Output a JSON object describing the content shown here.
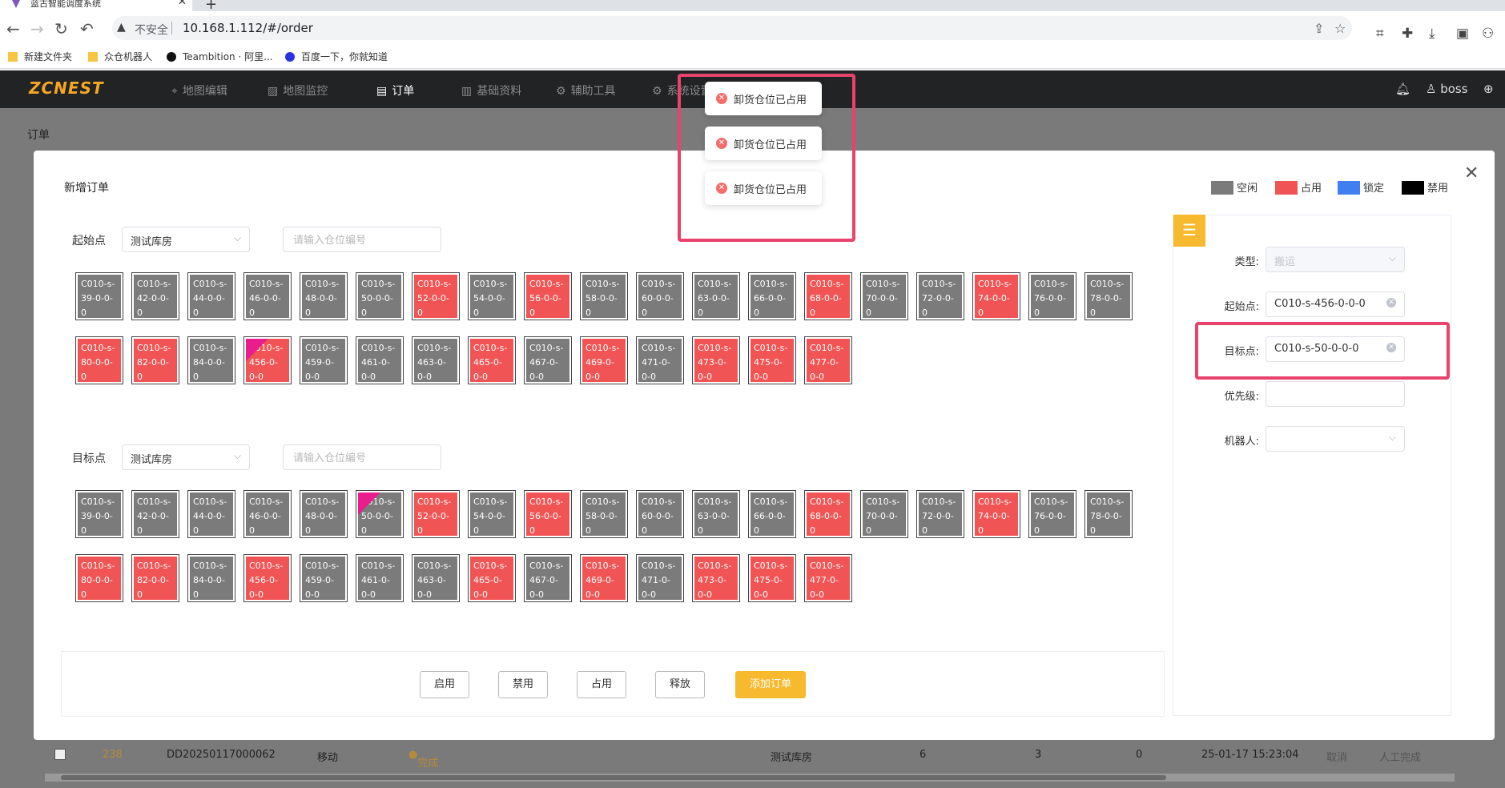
{
  "browser": {
    "tab_title": "蓝古智能调度系统",
    "url": "10.168.1.112/#/order",
    "insecure_label": "不安全",
    "bookmarks": [
      {
        "label": "新建文件夹",
        "icon": "folder-icon"
      },
      {
        "label": "众仓机器人",
        "icon": "folder-icon"
      },
      {
        "label": "Teambition · 阿里...",
        "icon": "teambition-icon"
      },
      {
        "label": "百度一下，你就知道",
        "icon": "baidu-icon"
      }
    ]
  },
  "app": {
    "logo": "ZCNEST",
    "menu": [
      {
        "label": "地图编辑",
        "icon": "map-pin-icon",
        "glyph": "⌖"
      },
      {
        "label": "地图监控",
        "icon": "monitor-icon",
        "glyph": "▨"
      },
      {
        "label": "订单",
        "icon": "order-icon",
        "glyph": "▤"
      },
      {
        "label": "基础资料",
        "icon": "data-icon",
        "glyph": "▥"
      },
      {
        "label": "辅助工具",
        "icon": "tools-icon",
        "glyph": "⚙"
      },
      {
        "label": "系统设置",
        "icon": "settings-icon",
        "glyph": "⚙"
      }
    ],
    "user": "boss",
    "breadcrumb": "订单"
  },
  "background_row": {
    "id": "238",
    "order_no": "DD20250117000062",
    "type": "移动",
    "status": "完成",
    "warehouse": "测试库房",
    "n1": "6",
    "n2": "3",
    "n3": "0",
    "time": "25-01-17 15:23:04",
    "cancel": "取消",
    "manual": "人工完成"
  },
  "modal": {
    "title": "新增订单",
    "legend": [
      {
        "label": "空闲",
        "color": "#7b7b7b"
      },
      {
        "label": "占用",
        "color": "#f05454"
      },
      {
        "label": "锁定",
        "color": "#3f7ff0"
      },
      {
        "label": "禁用",
        "color": "#000000"
      }
    ],
    "start_section": {
      "label": "起始点",
      "warehouse": "测试库房",
      "search_placeholder": "请输入仓位编号"
    },
    "target_section": {
      "label": "目标点",
      "warehouse": "测试库房",
      "search_placeholder": "请输入仓位编号"
    },
    "start_cells": [
      {
        "code": "C010-s-39-0-0-0",
        "state": "free"
      },
      {
        "code": "C010-s-42-0-0-0",
        "state": "free"
      },
      {
        "code": "C010-s-44-0-0-0",
        "state": "free"
      },
      {
        "code": "C010-s-46-0-0-0",
        "state": "free"
      },
      {
        "code": "C010-s-48-0-0-0",
        "state": "free"
      },
      {
        "code": "C010-s-50-0-0-0",
        "state": "free"
      },
      {
        "code": "C010-s-52-0-0-0",
        "state": "occupied"
      },
      {
        "code": "C010-s-54-0-0-0",
        "state": "free"
      },
      {
        "code": "C010-s-56-0-0-0",
        "state": "occupied"
      },
      {
        "code": "C010-s-58-0-0-0",
        "state": "free"
      },
      {
        "code": "C010-s-60-0-0-0",
        "state": "free"
      },
      {
        "code": "C010-s-63-0-0-0",
        "state": "free"
      },
      {
        "code": "C010-s-66-0-0-0",
        "state": "free"
      },
      {
        "code": "C010-s-68-0-0-0",
        "state": "occupied"
      },
      {
        "code": "C010-s-70-0-0-0",
        "state": "free"
      },
      {
        "code": "C010-s-72-0-0-0",
        "state": "free"
      },
      {
        "code": "C010-s-74-0-0-0",
        "state": "occupied"
      },
      {
        "code": "C010-s-76-0-0-0",
        "state": "free"
      },
      {
        "code": "C010-s-78-0-0-0",
        "state": "free"
      },
      {
        "code": "C010-s-80-0-0-0",
        "state": "occupied"
      },
      {
        "code": "C010-s-82-0-0-0",
        "state": "occupied"
      },
      {
        "code": "C010-s-84-0-0-0",
        "state": "free"
      },
      {
        "code": "C010-s-456-0-0-0",
        "state": "occupied",
        "selected": true
      },
      {
        "code": "C010-s-459-0-0-0",
        "state": "free"
      },
      {
        "code": "C010-s-461-0-0-0",
        "state": "free"
      },
      {
        "code": "C010-s-463-0-0-0",
        "state": "free"
      },
      {
        "code": "C010-s-465-0-0-0",
        "state": "occupied"
      },
      {
        "code": "C010-s-467-0-0-0",
        "state": "free"
      },
      {
        "code": "C010-s-469-0-0-0",
        "state": "occupied"
      },
      {
        "code": "C010-s-471-0-0-0",
        "state": "free"
      },
      {
        "code": "C010-s-473-0-0-0",
        "state": "occupied"
      },
      {
        "code": "C010-s-475-0-0-0",
        "state": "occupied"
      },
      {
        "code": "C010-s-477-0-0-0",
        "state": "occupied"
      }
    ],
    "target_cells": [
      {
        "code": "C010-s-39-0-0-0",
        "state": "free"
      },
      {
        "code": "C010-s-42-0-0-0",
        "state": "free"
      },
      {
        "code": "C010-s-44-0-0-0",
        "state": "free"
      },
      {
        "code": "C010-s-46-0-0-0",
        "state": "free"
      },
      {
        "code": "C010-s-48-0-0-0",
        "state": "free"
      },
      {
        "code": "C010-s-50-0-0-0",
        "state": "free",
        "selected": true
      },
      {
        "code": "C010-s-52-0-0-0",
        "state": "occupied"
      },
      {
        "code": "C010-s-54-0-0-0",
        "state": "free"
      },
      {
        "code": "C010-s-56-0-0-0",
        "state": "occupied"
      },
      {
        "code": "C010-s-58-0-0-0",
        "state": "free"
      },
      {
        "code": "C010-s-60-0-0-0",
        "state": "free"
      },
      {
        "code": "C010-s-63-0-0-0",
        "state": "free"
      },
      {
        "code": "C010-s-66-0-0-0",
        "state": "free"
      },
      {
        "code": "C010-s-68-0-0-0",
        "state": "occupied"
      },
      {
        "code": "C010-s-70-0-0-0",
        "state": "free"
      },
      {
        "code": "C010-s-72-0-0-0",
        "state": "free"
      },
      {
        "code": "C010-s-74-0-0-0",
        "state": "occupied"
      },
      {
        "code": "C010-s-76-0-0-0",
        "state": "free"
      },
      {
        "code": "C010-s-78-0-0-0",
        "state": "free"
      },
      {
        "code": "C010-s-80-0-0-0",
        "state": "occupied"
      },
      {
        "code": "C010-s-82-0-0-0",
        "state": "occupied"
      },
      {
        "code": "C010-s-84-0-0-0",
        "state": "free"
      },
      {
        "code": "C010-s-456-0-0-0",
        "state": "occupied"
      },
      {
        "code": "C010-s-459-0-0-0",
        "state": "free"
      },
      {
        "code": "C010-s-461-0-0-0",
        "state": "free"
      },
      {
        "code": "C010-s-463-0-0-0",
        "state": "free"
      },
      {
        "code": "C010-s-465-0-0-0",
        "state": "occupied"
      },
      {
        "code": "C010-s-467-0-0-0",
        "state": "free"
      },
      {
        "code": "C010-s-469-0-0-0",
        "state": "occupied"
      },
      {
        "code": "C010-s-471-0-0-0",
        "state": "free"
      },
      {
        "code": "C010-s-473-0-0-0",
        "state": "occupied"
      },
      {
        "code": "C010-s-475-0-0-0",
        "state": "occupied"
      },
      {
        "code": "C010-s-477-0-0-0",
        "state": "occupied"
      }
    ],
    "buttons": {
      "enable": "启用",
      "disable": "禁用",
      "occupy": "占用",
      "release": "释放",
      "add_order": "添加订单"
    },
    "form": {
      "type_label": "类型:",
      "type_value": "搬运",
      "start_label": "起始点:",
      "start_value": "C010-s-456-0-0-0",
      "target_label": "目标点:",
      "target_value": "C010-s-50-0-0-0",
      "priority_label": "优先级:",
      "priority_value": "",
      "robot_label": "机器人:",
      "robot_value": ""
    }
  },
  "toasts": [
    {
      "message": "卸货仓位已占用",
      "icon": "error-icon"
    },
    {
      "message": "卸货仓位已占用",
      "icon": "error-icon"
    },
    {
      "message": "卸货仓位已占用",
      "icon": "error-icon"
    }
  ],
  "colors": {
    "free": "#7b7b7b",
    "occupied": "#f05454",
    "accent": "#f7b92d",
    "highlight": "#e8436d"
  }
}
